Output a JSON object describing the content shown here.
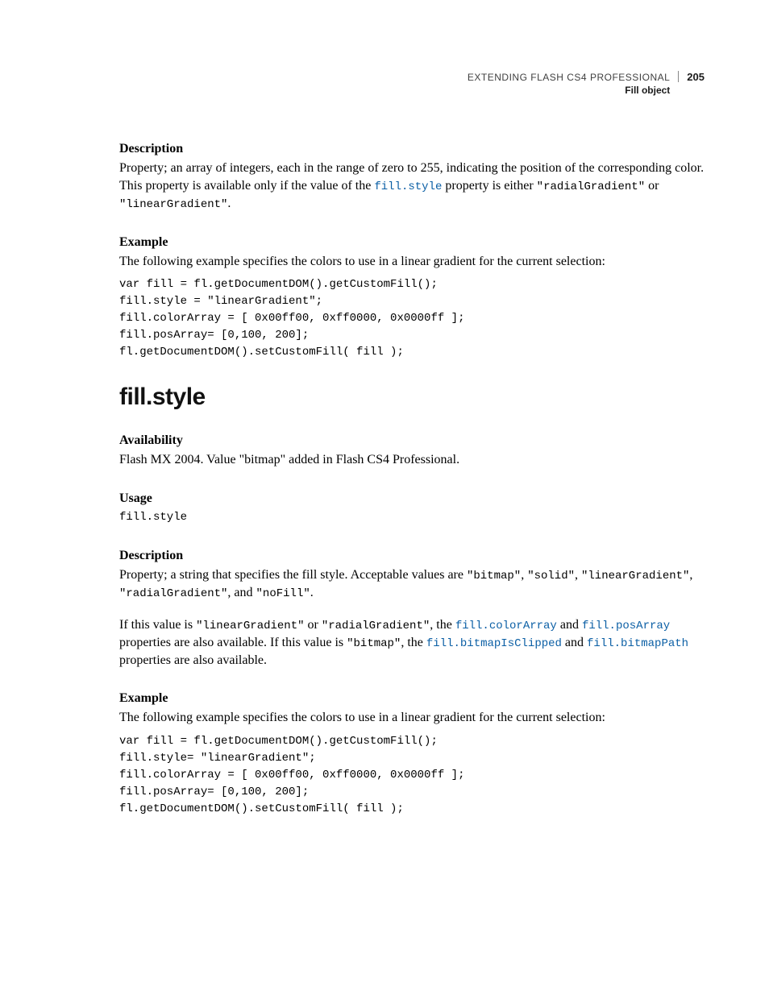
{
  "header": {
    "doc_title": "EXTENDING FLASH CS4 PROFESSIONAL",
    "section": "Fill object",
    "page_number": "205"
  },
  "s1": {
    "desc_h": "Description",
    "desc_p_a": "Property; an array of integers, each in the range of zero to 255, indicating the position of the corresponding color. This property is available only if the value of the ",
    "desc_link": "fill.style",
    "desc_p_b": " property is either ",
    "desc_c1": "\"radialGradient\"",
    "desc_or": " or ",
    "desc_c2": "\"linearGradient\"",
    "desc_end": ".",
    "ex_h": "Example",
    "ex_p": "The following example specifies the colors to use in a linear gradient for the current selection:",
    "code": "var fill = fl.getDocumentDOM().getCustomFill();\nfill.style = \"linearGradient\";\nfill.colorArray = [ 0x00ff00, 0xff0000, 0x0000ff ];\nfill.posArray= [0,100, 200];\nfl.getDocumentDOM().setCustomFill( fill );"
  },
  "s2": {
    "title": "fill.style",
    "avail_h": "Availability",
    "avail_p": "Flash MX 2004. Value \"bitmap\" added in Flash CS4 Professional.",
    "usage_h": "Usage",
    "usage_code": "fill.style",
    "desc_h": "Description",
    "desc_p1_a": "Property; a string that specifies the fill style. Acceptable values are ",
    "desc_p1_vals": {
      "v1": "\"bitmap\"",
      "v2": "\"solid\"",
      "v3": "\"linearGradient\"",
      "v4": "\"radialGradient\"",
      "v5": "\"noFill\""
    },
    "sep_comma": ", ",
    "sep_and": ", and ",
    "dot": ".",
    "desc_p2_a": "If this value is ",
    "desc_p2_v1": "\"linearGradient\"",
    "desc_p2_or": " or ",
    "desc_p2_v2": "\"radialGradient\"",
    "desc_p2_b": ", the ",
    "desc_p2_l1": "fill.colorArray",
    "desc_p2_and": " and ",
    "desc_p2_l2": "fill.posArray",
    "desc_p2_c": " properties are also available. If this value is ",
    "desc_p2_v3": "\"bitmap\"",
    "desc_p2_d": ", the ",
    "desc_p2_l3": "fill.bitmapIsClipped",
    "desc_p2_and2": " and ",
    "desc_p2_l4": "fill.bitmapPath",
    "desc_p2_e": " properties are also available.",
    "ex_h": "Example",
    "ex_p": "The following example specifies the colors to use in a linear gradient for the current selection:",
    "code": "var fill = fl.getDocumentDOM().getCustomFill();\nfill.style= \"linearGradient\";\nfill.colorArray = [ 0x00ff00, 0xff0000, 0x0000ff ];\nfill.posArray= [0,100, 200];\nfl.getDocumentDOM().setCustomFill( fill );"
  }
}
